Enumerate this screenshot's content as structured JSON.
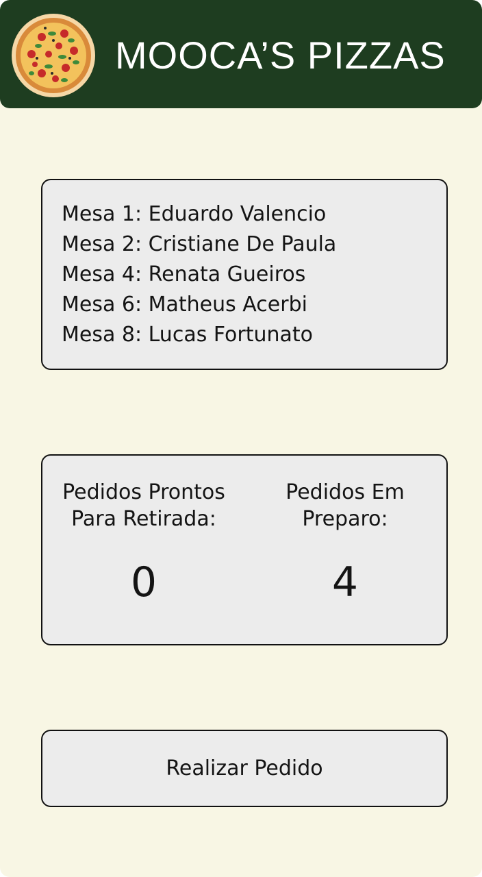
{
  "header": {
    "title": "MOOCA’S PIZZAS",
    "logo_icon": "pizza-icon"
  },
  "tables": [
    "Mesa 1: Eduardo Valencio",
    "Mesa 2: Cristiane De Paula",
    "Mesa 4: Renata Gueiros",
    "Mesa 6: Matheus Acerbi",
    "Mesa 8: Lucas Fortunato"
  ],
  "stats": {
    "ready_label_line1": "Pedidos Prontos",
    "ready_label_line2": "Para Retirada:",
    "ready_count": "0",
    "prep_label_line1": "Pedidos Em",
    "prep_label_line2": "Preparo:",
    "prep_count": "4"
  },
  "actions": {
    "order_button_label": "Realizar Pedido"
  },
  "colors": {
    "header_bg": "#1e3d20",
    "page_bg": "#f8f6e4",
    "card_bg": "#ececec"
  }
}
